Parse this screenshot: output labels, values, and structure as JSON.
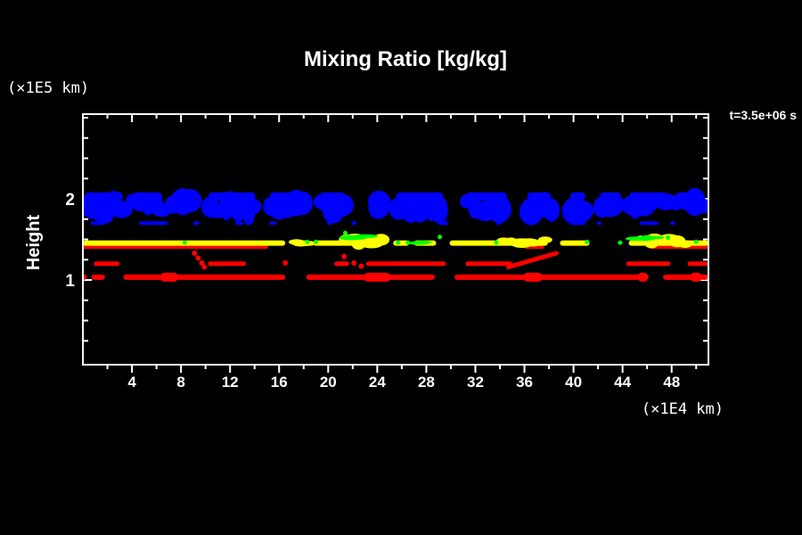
{
  "window": {
    "background": "#000000",
    "foreground": "#ffffff"
  },
  "chart_data": {
    "type": "heatmap",
    "title": "Mixing Ratio [kg/kg]",
    "annotation": "t=3.5e+06 s",
    "grid": false,
    "legend": "none",
    "xlim": [
      0,
      51
    ],
    "ylim": [
      0,
      3.04
    ],
    "x_axis": {
      "unit_label": "(×1E4 km)",
      "tick_labels": [
        4,
        8,
        12,
        16,
        20,
        24,
        28,
        32,
        36,
        40,
        44,
        48
      ],
      "major_step": 4,
      "minor_step": 2
    },
    "y_axis": {
      "label": "Height",
      "unit_label": "(×1E5 km)",
      "tick_labels": [
        1,
        2
      ],
      "minor_step": 0.25
    },
    "colors": {
      "cloud_blue": "#0000ff",
      "mixed_yellow": "#ffff00",
      "trace_green": "#00ff00",
      "vapor_red": "#ff0000",
      "axis_white": "#ffffff"
    },
    "layers": {
      "blue_clouds": {
        "color": "#0000ff",
        "band": [
          1.78,
          2.08
        ],
        "segments": [
          [
            0,
            3.4
          ],
          [
            3.9,
            6.6
          ],
          [
            7.1,
            8.8
          ],
          [
            10.1,
            14.2
          ],
          [
            15.1,
            18.2
          ],
          [
            19.2,
            21.5
          ],
          [
            23.9,
            24.6
          ],
          [
            25.4,
            29.5
          ],
          [
            31.1,
            34.7
          ],
          [
            36.1,
            38.3
          ],
          [
            39.6,
            41.1
          ],
          [
            42.0,
            44.0
          ],
          [
            44.4,
            47.8
          ],
          [
            48.2,
            50.8
          ]
        ]
      },
      "blue_wisps": {
        "color": "#0000ff",
        "y": 1.7,
        "segments": [
          [
            0.6,
            1.8
          ],
          [
            4.6,
            6.9
          ],
          [
            9.0,
            9.5
          ],
          [
            12.4,
            13.1
          ],
          [
            15.2,
            15.8
          ],
          [
            19.9,
            20.3
          ],
          [
            21.9,
            22.3
          ],
          [
            29.0,
            29.8
          ],
          [
            33.7,
            34.1
          ],
          [
            36.2,
            36.9
          ],
          [
            39.7,
            41.0
          ],
          [
            41.9,
            42.3
          ],
          [
            45.4,
            46.9
          ],
          [
            47.9,
            48.3
          ]
        ]
      },
      "yellow_line": {
        "color": "#ffff00",
        "y": 1.455,
        "segments": [
          [
            0,
            16.5
          ],
          [
            17.2,
            18.4
          ],
          [
            18.8,
            24.5
          ],
          [
            25.3,
            26.6
          ],
          [
            27.0,
            28.8
          ],
          [
            29.9,
            37.9
          ],
          [
            38.9,
            41.3
          ],
          [
            44.5,
            51
          ]
        ]
      },
      "yellow_blobs": [
        {
          "x": [
            21.3,
            24.5
          ],
          "v": [
            1.42,
            1.57
          ]
        },
        {
          "x": [
            34.1,
            37.8
          ],
          "v": [
            1.43,
            1.53
          ]
        },
        {
          "x": [
            45.4,
            49.2
          ],
          "v": [
            1.42,
            1.55
          ]
        },
        {
          "x": [
            17.3,
            18.4
          ],
          "v": [
            1.43,
            1.51
          ]
        }
      ],
      "green_patches": [
        {
          "x": [
            21.4,
            23.2
          ],
          "v": [
            1.5,
            1.57
          ]
        },
        {
          "x": [
            44.7,
            47.1
          ],
          "v": [
            1.49,
            1.55
          ]
        },
        {
          "x": [
            27.1,
            27.9
          ],
          "v": [
            1.44,
            1.49
          ]
        }
      ],
      "green_specks": [
        [
          8.3,
          1.46
        ],
        [
          18.3,
          1.47
        ],
        [
          19.0,
          1.47
        ],
        [
          25.7,
          1.46
        ],
        [
          26.5,
          1.46
        ],
        [
          29.1,
          1.53
        ],
        [
          33.7,
          1.46
        ],
        [
          41.1,
          1.47
        ],
        [
          43.8,
          1.46
        ],
        [
          47.7,
          1.52
        ],
        [
          50.0,
          1.47
        ],
        [
          21.4,
          1.58
        ]
      ],
      "red_under_yellow": {
        "color": "#ff0000",
        "y": 1.405,
        "segments": [
          [
            0,
            15.1
          ],
          [
            36.0,
            37.6
          ],
          [
            46.2,
            51
          ]
        ]
      },
      "red_mid": {
        "color": "#ff0000",
        "y": 1.2,
        "segments": [
          [
            0.9,
            3.0
          ],
          [
            10.2,
            13.3
          ],
          [
            20.5,
            21.7
          ],
          [
            23.1,
            29.6
          ],
          [
            31.2,
            35.0
          ],
          [
            44.3,
            47.9
          ],
          [
            49.3,
            51
          ]
        ]
      },
      "red_diag": {
        "from": [
          34.7,
          1.16
        ],
        "to": [
          38.6,
          1.33
        ]
      },
      "red_specks": [
        [
          9.1,
          1.33
        ],
        [
          9.4,
          1.27
        ],
        [
          9.7,
          1.21
        ],
        [
          9.9,
          1.16
        ],
        [
          21.3,
          1.29
        ],
        [
          22.1,
          1.21
        ],
        [
          22.7,
          1.17
        ],
        [
          16.5,
          1.21
        ]
      ],
      "red_low": {
        "color": "#ff0000",
        "y": 1.035,
        "segments": [
          [
            0,
            0.3
          ],
          [
            0.7,
            1.8
          ],
          [
            3.3,
            16.5
          ],
          [
            18.2,
            28.7
          ],
          [
            30.3,
            46.1
          ],
          [
            47.3,
            51
          ]
        ]
      },
      "red_low_lumps": [
        [
          6.3,
          7.8
        ],
        [
          22.9,
          25.1
        ],
        [
          35.9,
          37.5
        ],
        [
          45.2,
          46.1
        ],
        [
          49.5,
          50.5
        ]
      ]
    }
  }
}
